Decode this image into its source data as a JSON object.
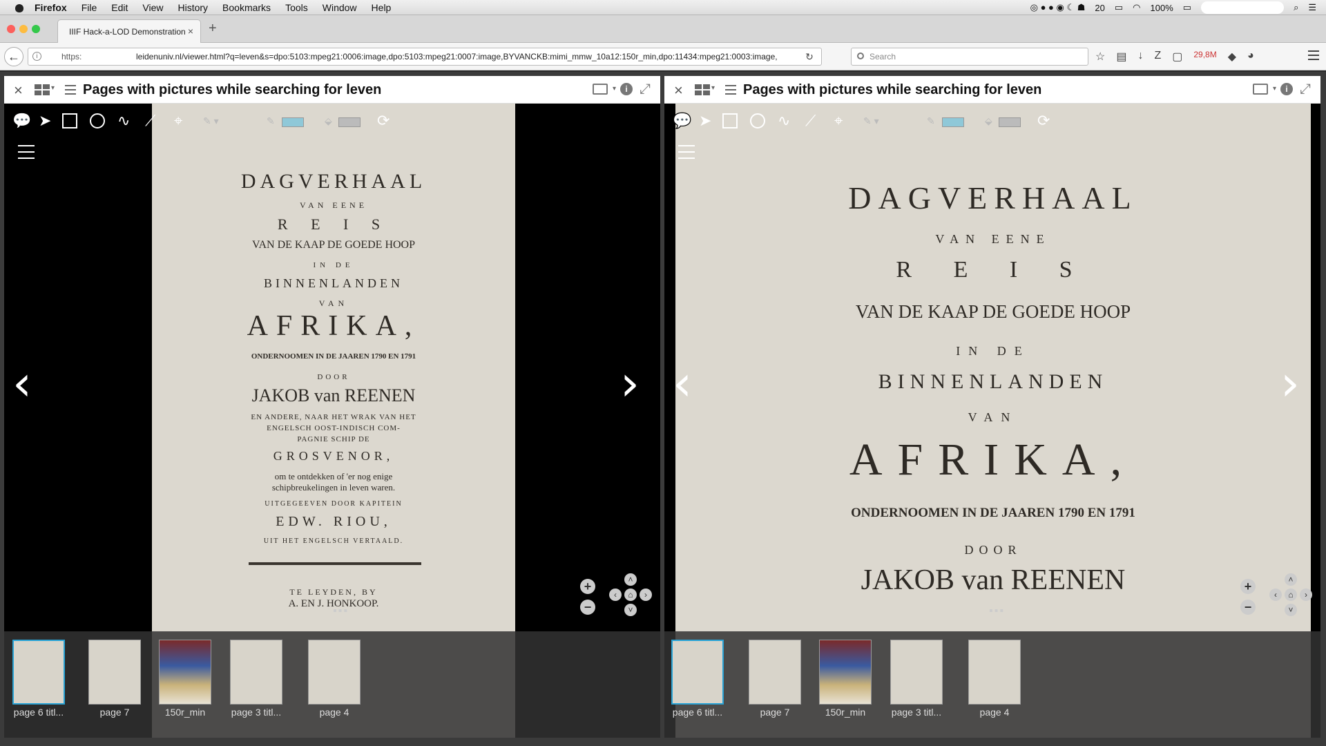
{
  "menubar": {
    "items": [
      "Firefox",
      "File",
      "Edit",
      "View",
      "History",
      "Bookmarks",
      "Tools",
      "Window",
      "Help"
    ],
    "status": {
      "notifications": "20",
      "battery": "100%"
    }
  },
  "browser": {
    "tab_title": "IIIF Hack-a-LOD Demonstration",
    "url_protocol": "https:",
    "url": "leidenuniv.nl/viewer.html?q=leven&s=dpo:5103:mpeg21:0006:image,dpo:5103:mpeg21:0007:image,BYVANCKB:mimi_mmw_10a12:150r_min,dpo:11434:mpeg21:0003:image,",
    "search_placeholder": "Search",
    "memory": "29,8M"
  },
  "windows": [
    {
      "title": "Pages with pictures while searching for leven",
      "thumbnails": [
        {
          "label": "page 6 titl...",
          "selected": true
        },
        {
          "label": "page 7",
          "selected": false
        },
        {
          "label": "150r_min",
          "selected": false
        },
        {
          "label": "page 3 titl...",
          "selected": false
        },
        {
          "label": "page 4",
          "selected": false
        }
      ]
    },
    {
      "title": "Pages with pictures while searching for leven",
      "thumbnails": [
        {
          "label": "page 6 titl...",
          "selected": true
        },
        {
          "label": "page 7",
          "selected": false
        },
        {
          "label": "150r_min",
          "selected": false
        },
        {
          "label": "page 3 titl...",
          "selected": false
        },
        {
          "label": "page 4",
          "selected": false
        }
      ]
    }
  ],
  "page_text": {
    "l1": "DAGVERHAAL",
    "l2": "VAN EENE",
    "l3": "R  E  I  S",
    "l4": "VAN DE KAAP DE GOEDE HOOP",
    "l5": "IN DE",
    "l6": "BINNENLANDEN",
    "l7": "VAN",
    "l8": "AFRIKA,",
    "l9": "ONDERNOOMEN IN DE JAAREN 1790 EN 1791",
    "l10": "DOOR",
    "l11": "JAKOB van REENEN",
    "l12": "EN ANDERE, NAAR HET WRAK VAN HET",
    "l13": "ENGELSCH OOST-INDISCH COM-",
    "l14": "PAGNIE SCHIP DE",
    "l15": "GROSVENOR,",
    "l16": "om te ontdekken of 'er nog enige",
    "l17": "schipbreukelingen in leven waren.",
    "l18": "UITGEGEEVEN DOOR KAPITEIN",
    "l19": "EDW. RIOU,",
    "l20": "UIT HET ENGELSCH VERTAALD.",
    "l21": "TE LEYDEN, BY",
    "l22": "A. EN J. HONKOOP."
  },
  "colors": {
    "accent": "#29a3d5",
    "swatch": "#8fc8d8"
  }
}
